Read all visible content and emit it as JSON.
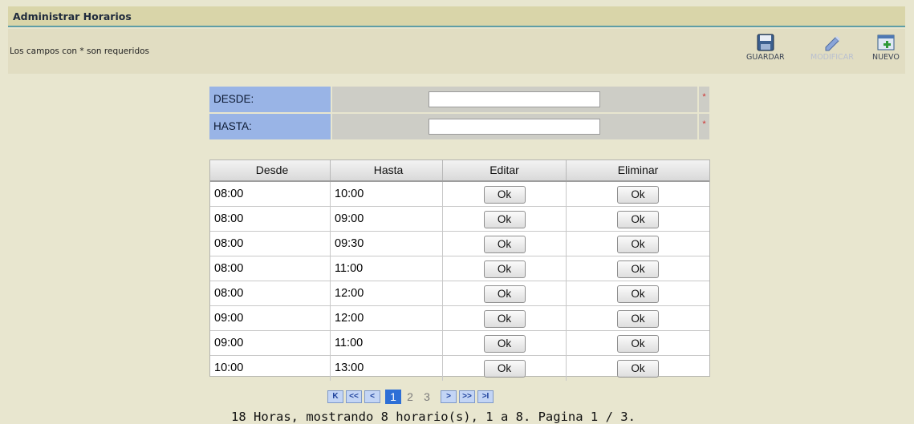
{
  "title": "Administrar Horarios",
  "required_note": "Los campos con * son requeridos",
  "toolbar": {
    "guardar": "GUARDAR",
    "modificar": "MODIFICAR",
    "nuevo": "NUEVO"
  },
  "form": {
    "desde_label": "DESDE:",
    "hasta_label": "HASTA:",
    "desde_value": "",
    "hasta_value": "",
    "required_mark": "*"
  },
  "table": {
    "headers": [
      "Desde",
      "Hasta",
      "Editar",
      "Eliminar"
    ],
    "button_label": "Ok",
    "rows": [
      {
        "desde": "08:00",
        "hasta": "10:00"
      },
      {
        "desde": "08:00",
        "hasta": "09:00"
      },
      {
        "desde": "08:00",
        "hasta": "09:30"
      },
      {
        "desde": "08:00",
        "hasta": "11:00"
      },
      {
        "desde": "08:00",
        "hasta": "12:00"
      },
      {
        "desde": "09:00",
        "hasta": "12:00"
      },
      {
        "desde": "09:00",
        "hasta": "11:00"
      },
      {
        "desde": "10:00",
        "hasta": "13:00"
      }
    ]
  },
  "pager": {
    "first": "K",
    "prev_block": "<<",
    "prev": "<",
    "pages": [
      "1",
      "2",
      "3"
    ],
    "current_page": "1",
    "next": ">",
    "next_block": ">>",
    "last": ">I",
    "summary": "18 Horas, mostrando 8 horario(s), 1 a 8. Pagina 1 / 3."
  },
  "colors": {
    "title_bg": "#d9d5a9",
    "label_bg": "#99b4e6",
    "page_bg": "#e8e6cf",
    "active_page": "#2d6fd6"
  }
}
